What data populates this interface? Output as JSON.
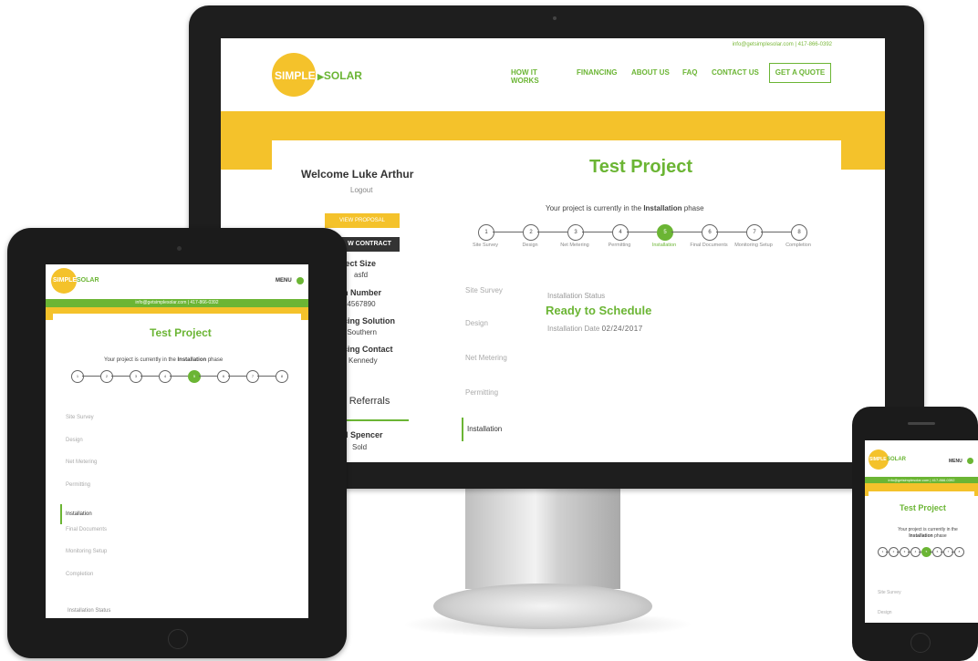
{
  "brand": {
    "simple": "SIMPLE",
    "solar": "SOLAR",
    "arrow": "▶"
  },
  "colors": {
    "green": "#6bb534",
    "yellow": "#f4c22b",
    "bezel": "#1e1e1e"
  },
  "desktop": {
    "contact_line": "info@getsimplesolar.com | 417-866-0392",
    "nav": [
      "HOW IT WORKS",
      "FINANCING",
      "ABOUT US",
      "FAQ",
      "CONTACT US"
    ],
    "quote_button": "GET A QUOTE",
    "welcome": "Welcome Luke Arthur",
    "logout": "Logout",
    "view_proposal": "VIEW PROPOSAL",
    "view_contract": "W CONTRACT",
    "sidebar_info": [
      {
        "label": "ject Size",
        "value": "asfd"
      },
      {
        "label": "n Number",
        "value": "34567890"
      },
      {
        "label": "cing Solution",
        "value": "t Southern"
      },
      {
        "label": "cing Contact",
        "value": "Kennedy"
      }
    ],
    "referrals_heading": "r Referrals",
    "referral_name": "d Spencer",
    "referral_status": "Sold",
    "project_title": "Test Project",
    "phase_prefix": "Your project is currently in the ",
    "phase_name": "Installation",
    "phase_suffix": " phase",
    "steps": [
      {
        "num": "1",
        "label": "Site Survey"
      },
      {
        "num": "2",
        "label": "Design"
      },
      {
        "num": "3",
        "label": "Net Metering"
      },
      {
        "num": "4",
        "label": "Permitting"
      },
      {
        "num": "5",
        "label": "Installation"
      },
      {
        "num": "6",
        "label": "Final Documents"
      },
      {
        "num": "7",
        "label": "Monitoring Setup"
      },
      {
        "num": "8",
        "label": "Completion"
      }
    ],
    "active_step": 5,
    "tabs": [
      "Site Survey",
      "Design",
      "Net Metering",
      "Permitting",
      "Installation"
    ],
    "status_label": "Installation Status",
    "status_value": "Ready to Schedule",
    "install_date_label": "Installation Date",
    "install_date": "02/24/2017"
  },
  "tablet": {
    "menu": "MENU",
    "contact_line": "info@getsimplesolar.com | 417-866-0392",
    "project_title": "Test Project",
    "phase_prefix": "Your project is currently in the ",
    "phase_name": "Installation",
    "phase_suffix": " phase",
    "steps": [
      "1",
      "2",
      "3",
      "4",
      "5",
      "6",
      "7",
      "8"
    ],
    "active_step": 5,
    "tabs": [
      "Site Survey",
      "Design",
      "Net Metering",
      "Permitting",
      "Installation",
      "Final Documents",
      "Monitoring Setup",
      "Completion"
    ],
    "status_label": "Installation Status"
  },
  "phone": {
    "menu": "MENU",
    "contact_line": "info@getsimplesolar.com | 417-866-0392",
    "project_title": "Test Project",
    "phase_line1": "Your project is currently in the",
    "phase_name": "Installation",
    "phase_suffix": " phase",
    "steps": [
      "1",
      "2",
      "3",
      "4",
      "5",
      "6",
      "7",
      "8"
    ],
    "active_step": 5,
    "tabs": [
      "Site Survey",
      "Design"
    ]
  }
}
